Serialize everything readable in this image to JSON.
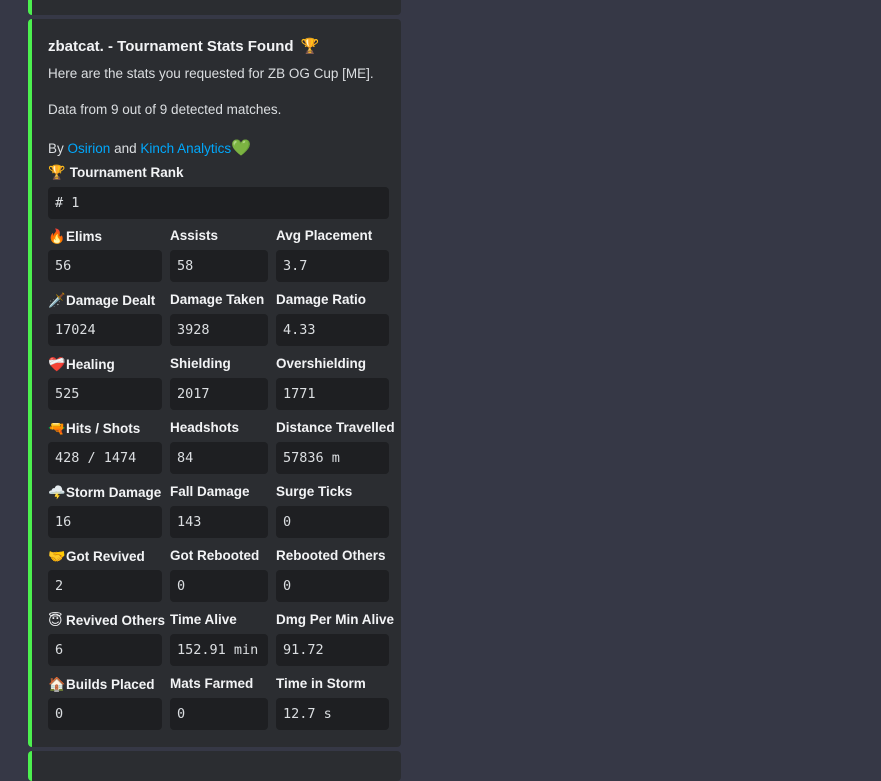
{
  "embed": {
    "title": "zbatcat. - Tournament Stats Found",
    "title_icon": "🏆",
    "description_line1": "Here are the stats you requested for ZB OG Cup [ME].",
    "description_line2": "Data from 9 out of 9 detected matches.",
    "credit_prefix": "By",
    "credit_link1": "Osirion",
    "credit_and": "and",
    "credit_link2": "Kinch Analytics",
    "credit_heart": "💚",
    "accent_color": "#4cf04f",
    "link_color": "#00a8fc"
  },
  "rank": {
    "emoji": "🏆",
    "label": "Tournament Rank",
    "value": "# 1"
  },
  "rows": [
    {
      "emoji": "🔥",
      "fields": [
        {
          "label": "Elims",
          "value": "56"
        },
        {
          "label": "Assists",
          "value": "58"
        },
        {
          "label": "Avg Placement",
          "value": "3.7"
        }
      ]
    },
    {
      "emoji": "🗡️",
      "fields": [
        {
          "label": "Damage Dealt",
          "value": "17024"
        },
        {
          "label": "Damage Taken",
          "value": "3928"
        },
        {
          "label": "Damage Ratio",
          "value": "4.33"
        }
      ]
    },
    {
      "emoji": "❤️‍🩹",
      "fields": [
        {
          "label": "Healing",
          "value": "525"
        },
        {
          "label": "Shielding",
          "value": "2017"
        },
        {
          "label": "Overshielding",
          "value": "1771"
        }
      ]
    },
    {
      "emoji": "🔫",
      "fields": [
        {
          "label": "Hits / Shots",
          "value": "428 / 1474"
        },
        {
          "label": "Headshots",
          "value": "84"
        },
        {
          "label": "Distance Travelled",
          "value": "57836 m"
        }
      ]
    },
    {
      "emoji": "🌩️",
      "fields": [
        {
          "label": "Storm Damage",
          "value": "16"
        },
        {
          "label": "Fall Damage",
          "value": "143"
        },
        {
          "label": "Surge Ticks",
          "value": "0"
        }
      ]
    },
    {
      "emoji": "🤝",
      "fields": [
        {
          "label": "Got Revived",
          "value": "2"
        },
        {
          "label": "Got Rebooted",
          "value": "0"
        },
        {
          "label": "Rebooted Others",
          "value": "0"
        }
      ]
    },
    {
      "emoji": "😇",
      "fields": [
        {
          "label": "Revived Others",
          "value": "6"
        },
        {
          "label": "Time Alive",
          "value": "152.91 min"
        },
        {
          "label": "Dmg Per Min Alive",
          "value": "91.72"
        }
      ]
    },
    {
      "emoji": "🏠",
      "fields": [
        {
          "label": "Builds Placed",
          "value": "0"
        },
        {
          "label": "Mats Farmed",
          "value": "0"
        },
        {
          "label": "Time in Storm",
          "value": "12.7 s"
        }
      ]
    }
  ]
}
